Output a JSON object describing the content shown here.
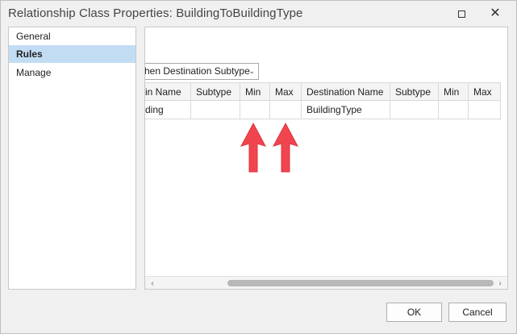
{
  "window": {
    "title": "Relationship Class Properties: BuildingToBuildingType",
    "maximize_icon": "maximize-icon",
    "close_icon": "close-icon",
    "close_glyph": "✕"
  },
  "nav": {
    "items": [
      {
        "label": "General",
        "selected": false
      },
      {
        "label": "Rules",
        "selected": true
      },
      {
        "label": "Manage",
        "selected": false
      }
    ]
  },
  "rules": {
    "dropdown_value": "hen Destination Subtype",
    "dropdown_chevron": "⌄",
    "columns": [
      {
        "label": "in Name"
      },
      {
        "label": "Subtype"
      },
      {
        "label": "Min"
      },
      {
        "label": "Max"
      },
      {
        "label": "Destination Name"
      },
      {
        "label": "Subtype"
      },
      {
        "label": "Min"
      },
      {
        "label": "Max"
      }
    ],
    "rows": [
      [
        "ding",
        "",
        "",
        "",
        "BuildingType",
        "",
        "",
        ""
      ]
    ],
    "scroll_left_glyph": "‹",
    "scroll_right_glyph": "›"
  },
  "annotations": {
    "arrow_color": "#f0454f",
    "arrows": [
      "red-arrow-min",
      "red-arrow-max"
    ]
  },
  "buttons": {
    "ok": "OK",
    "cancel": "Cancel"
  },
  "colors": {
    "selection": "#c2ddf3",
    "window_bg": "#f0f0f0"
  }
}
